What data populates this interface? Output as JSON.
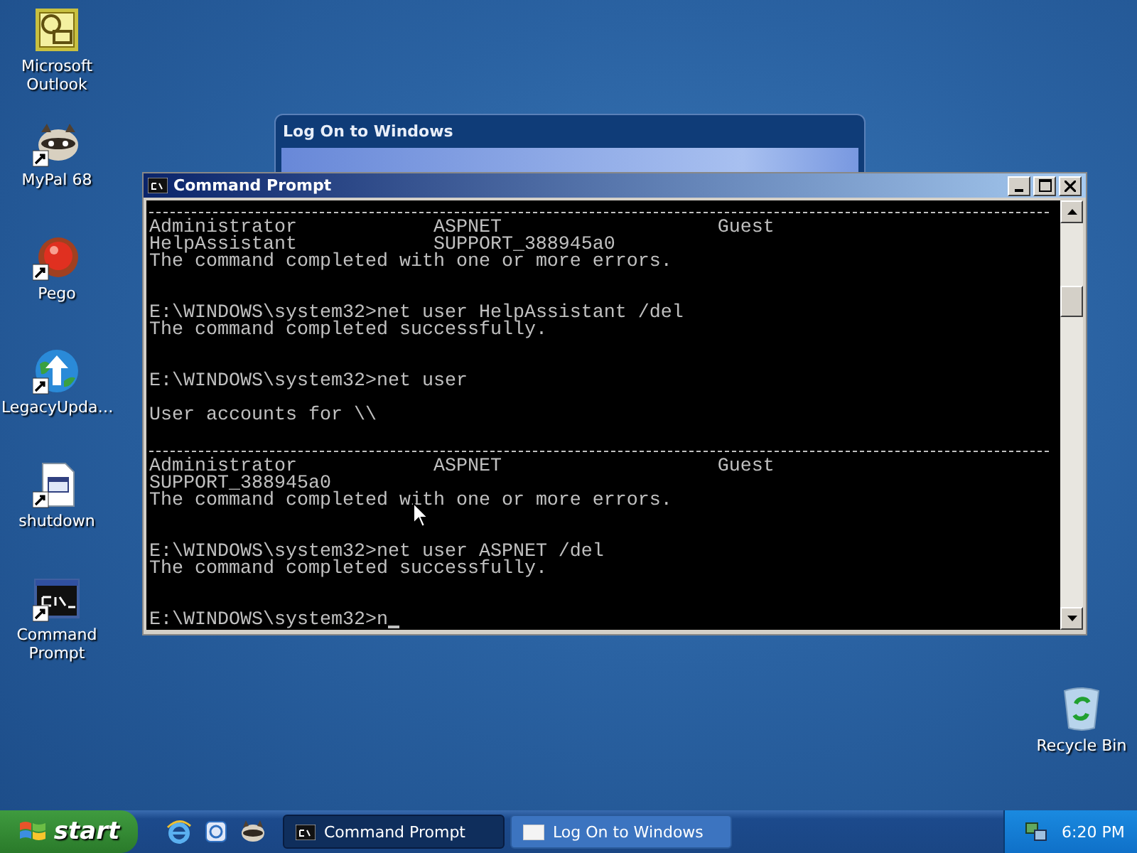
{
  "desktop_icons": [
    {
      "label": "Microsoft Outlook",
      "kind": "outlook",
      "shortcut": false
    },
    {
      "label": "MyPal 68",
      "kind": "raccoon",
      "shortcut": true
    },
    {
      "label": "Pego",
      "kind": "button",
      "shortcut": true
    },
    {
      "label": "LegacyUpda…",
      "kind": "globe",
      "shortcut": true
    },
    {
      "label": "shutdown",
      "kind": "file",
      "shortcut": true
    },
    {
      "label": "Command Prompt",
      "kind": "console",
      "shortcut": true
    }
  ],
  "recycle_bin": {
    "label": "Recycle Bin"
  },
  "background_window": {
    "title": "Log On to Windows"
  },
  "console_window": {
    "title": "Command Prompt",
    "lines": [
      {
        "kind": "rule"
      },
      {
        "kind": "columns",
        "cells": [
          "Administrator",
          "ASPNET",
          "Guest"
        ]
      },
      {
        "kind": "columns",
        "cells": [
          "HelpAssistant",
          "SUPPORT_388945a0"
        ]
      },
      {
        "kind": "text",
        "text": "The command completed with one or more errors."
      },
      {
        "kind": "blank"
      },
      {
        "kind": "blank"
      },
      {
        "kind": "text",
        "text": "E:\\WINDOWS\\system32>net user HelpAssistant /del"
      },
      {
        "kind": "text",
        "text": "The command completed successfully."
      },
      {
        "kind": "blank"
      },
      {
        "kind": "blank"
      },
      {
        "kind": "text",
        "text": "E:\\WINDOWS\\system32>net user"
      },
      {
        "kind": "blank"
      },
      {
        "kind": "text",
        "text": "User accounts for \\\\"
      },
      {
        "kind": "blank"
      },
      {
        "kind": "rule"
      },
      {
        "kind": "columns",
        "cells": [
          "Administrator",
          "ASPNET",
          "Guest"
        ]
      },
      {
        "kind": "text",
        "text": "SUPPORT_388945a0"
      },
      {
        "kind": "text",
        "text": "The command completed with one or more errors."
      },
      {
        "kind": "blank"
      },
      {
        "kind": "blank"
      },
      {
        "kind": "text",
        "text": "E:\\WINDOWS\\system32>net user ASPNET /del"
      },
      {
        "kind": "text",
        "text": "The command completed successfully."
      },
      {
        "kind": "blank"
      },
      {
        "kind": "blank"
      },
      {
        "kind": "text",
        "text": "E:\\WINDOWS\\system32>n",
        "cursor": true
      }
    ]
  },
  "taskbar": {
    "start_label": "start",
    "quick_launch": [
      {
        "kind": "browser"
      },
      {
        "kind": "email"
      },
      {
        "kind": "raccoon"
      }
    ],
    "tasks": [
      {
        "label": "Command Prompt",
        "selected": true,
        "kind": "console"
      },
      {
        "label": "Log On to Windows",
        "selected": false,
        "kind": "window"
      }
    ],
    "clock": "6:20 PM"
  }
}
